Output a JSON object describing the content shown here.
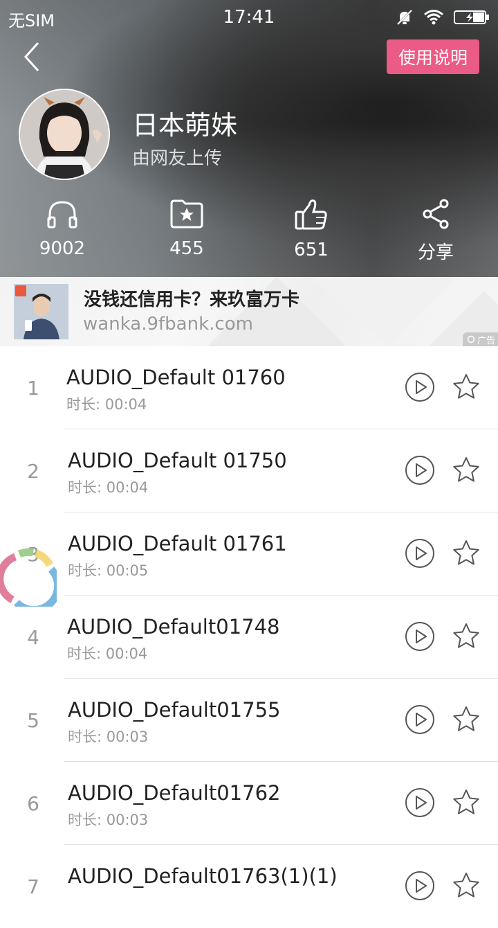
{
  "status_bar": {
    "carrier": "无SIM",
    "time": "17:41"
  },
  "header": {
    "guide_button": "使用说明",
    "title": "日本萌妹",
    "subtitle": "由网友上传"
  },
  "stats": [
    {
      "icon": "headphones-icon",
      "value": "9002"
    },
    {
      "icon": "folder-star-icon",
      "value": "455"
    },
    {
      "icon": "thumbs-up-icon",
      "value": "651"
    },
    {
      "icon": "share-icon",
      "value": "分享"
    }
  ],
  "ad": {
    "title": "没钱还信用卡？来玖富万卡",
    "url": "wanka.9fbank.com",
    "badge": "广告"
  },
  "tracks": [
    {
      "num": "1",
      "name": "AUDIO_Default 01760",
      "duration": "时长: 00:04"
    },
    {
      "num": "2",
      "name": "AUDIO_Default 01750",
      "duration": "时长: 00:04"
    },
    {
      "num": "3",
      "name": "AUDIO_Default 01761",
      "duration": "时长: 00:05"
    },
    {
      "num": "4",
      "name": "AUDIO_Default01748",
      "duration": "时长: 00:04"
    },
    {
      "num": "5",
      "name": "AUDIO_Default01755",
      "duration": "时长: 00:03"
    },
    {
      "num": "6",
      "name": "AUDIO_Default01762",
      "duration": "时长: 00:03"
    },
    {
      "num": "7",
      "name": "AUDIO_Default01763(1)(1)",
      "duration": ""
    }
  ],
  "colors": {
    "accent": "#ea5b85",
    "text": "#222222",
    "muted": "#999999"
  }
}
